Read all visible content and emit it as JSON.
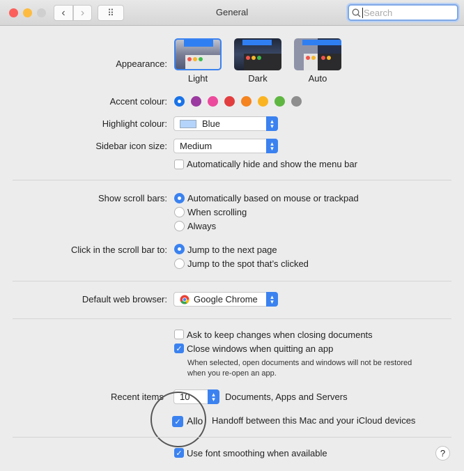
{
  "window": {
    "title": "General",
    "search_placeholder": "Search"
  },
  "toolbar": {
    "back": "‹",
    "forward": "›",
    "grid": "⠿"
  },
  "appearance": {
    "label": "Appearance:",
    "options": [
      {
        "label": "Light",
        "selected": true
      },
      {
        "label": "Dark",
        "selected": false
      },
      {
        "label": "Auto",
        "selected": false
      }
    ]
  },
  "accent": {
    "label": "Accent colour:",
    "colors": [
      "#1a73e8",
      "#9b3aa0",
      "#ec4a9c",
      "#e23e3f",
      "#f5831f",
      "#fbb421",
      "#5fb742",
      "#8e8e8e"
    ],
    "selected_index": 0
  },
  "highlight": {
    "label": "Highlight colour:",
    "value": "Blue",
    "swatch": "#b4d4fb"
  },
  "sidebar_icon_size": {
    "label": "Sidebar icon size:",
    "value": "Medium"
  },
  "menubar_autohide": {
    "label": "Automatically hide and show the menu bar",
    "checked": false
  },
  "scroll_bars": {
    "label": "Show scroll bars:",
    "options": [
      {
        "label": "Automatically based on mouse or trackpad",
        "selected": true
      },
      {
        "label": "When scrolling",
        "selected": false
      },
      {
        "label": "Always",
        "selected": false
      }
    ]
  },
  "scroll_click": {
    "label": "Click in the scroll bar to:",
    "options": [
      {
        "label": "Jump to the next page",
        "selected": true
      },
      {
        "label": "Jump to the spot that’s clicked",
        "selected": false
      }
    ]
  },
  "browser": {
    "label": "Default web browser:",
    "value": "Google Chrome"
  },
  "ask_keep": {
    "label": "Ask to keep changes when closing documents",
    "checked": false
  },
  "close_windows": {
    "label": "Close windows when quitting an app",
    "checked": true,
    "note_line1": "When selected, open documents and windows will not be restored",
    "note_line2": "when you re-open an app."
  },
  "recent": {
    "label": "Recent items",
    "value": "10",
    "suffix": "Documents, Apps and Servers"
  },
  "handoff": {
    "label_a": "Allo",
    "label_b": "Handoff between this Mac and your iCloud devices",
    "checked": true
  },
  "font_smoothing": {
    "label": "Use font smoothing when available",
    "checked": true
  },
  "help": "?"
}
